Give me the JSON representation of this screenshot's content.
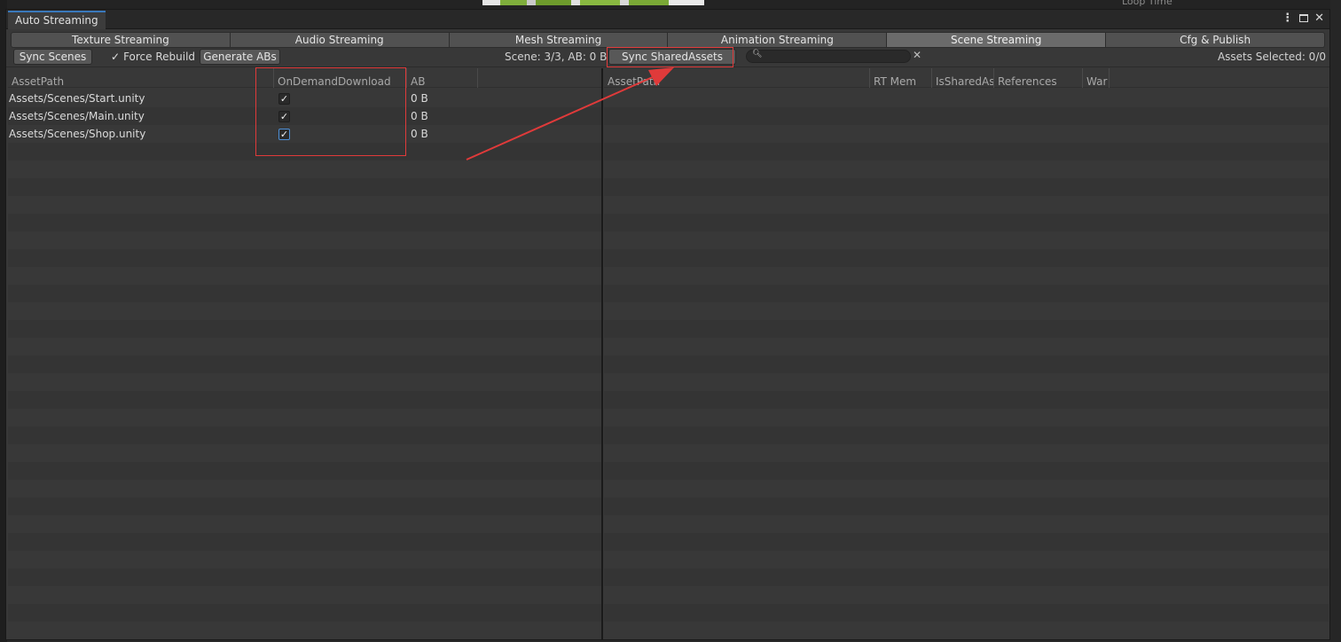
{
  "background": {
    "right_label": "Loop Time"
  },
  "window": {
    "title": "Auto Streaming",
    "menu_icon": "kebab-menu-icon",
    "maximize_icon": "maximize-icon",
    "close_icon": "close-icon"
  },
  "tabs": [
    {
      "label": "Texture Streaming",
      "active": false
    },
    {
      "label": "Audio Streaming",
      "active": false
    },
    {
      "label": "Mesh Streaming",
      "active": false
    },
    {
      "label": "Animation Streaming",
      "active": false
    },
    {
      "label": "Scene Streaming",
      "active": true
    },
    {
      "label": "Cfg & Publish",
      "active": false
    }
  ],
  "toolbar": {
    "sync_scenes_label": "Sync Scenes",
    "force_rebuild_label": "Force Rebuild",
    "force_rebuild_checked": true,
    "generate_abs_label": "Generate ABs",
    "scene_info": "Scene: 3/3, AB: 0 B",
    "sync_shared_label": "Sync SharedAssets",
    "search_value": "",
    "assets_selected": "Assets Selected: 0/0"
  },
  "left_table": {
    "columns": [
      "AssetPath",
      "OnDemandDownload",
      "AB"
    ],
    "rows": [
      {
        "path": "Assets/Scenes/Start.unity",
        "on_demand": true,
        "ab": "0 B"
      },
      {
        "path": "Assets/Scenes/Main.unity",
        "on_demand": true,
        "ab": "0 B"
      },
      {
        "path": "Assets/Scenes/Shop.unity",
        "on_demand": true,
        "ab": "0 B"
      }
    ]
  },
  "right_table": {
    "columns": [
      "AssetPath",
      "RT Mem",
      "IsSharedAs",
      "References",
      "War"
    ],
    "rows": []
  },
  "annotation_color": "#e03a3a",
  "accent_color": "#3a79bb"
}
